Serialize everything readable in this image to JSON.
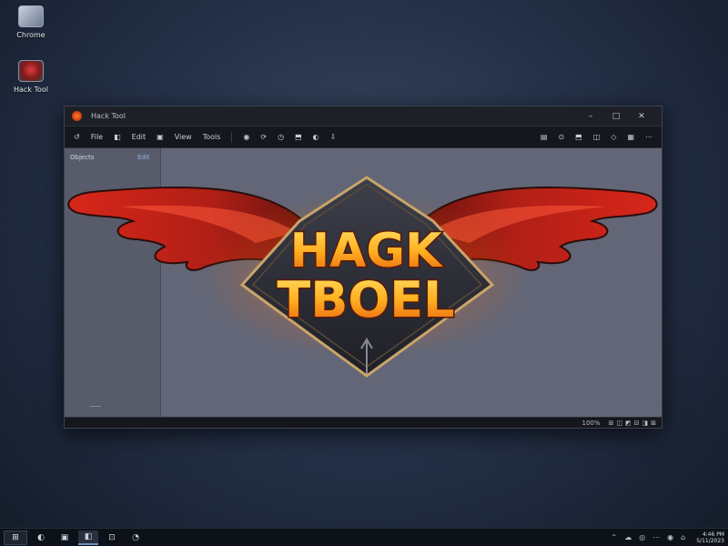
{
  "desktop": {
    "icons": [
      {
        "label": "Chrome",
        "icon": "app-icon"
      },
      {
        "label": "Hack Tool",
        "icon": "bat-logo-icon"
      }
    ]
  },
  "window": {
    "title": "Hack Tool",
    "controls": {
      "minimize": "–",
      "maximize": "□",
      "close": "✕"
    },
    "toolbar": {
      "left": [
        {
          "label": "↺",
          "icon": "refresh-icon"
        },
        {
          "label": "File",
          "icon": ""
        },
        {
          "label": "◧",
          "icon": "layers-icon"
        },
        {
          "label": "Edit",
          "icon": ""
        },
        {
          "label": "▣",
          "icon": "frame-icon"
        },
        {
          "label": "View",
          "icon": ""
        },
        {
          "label": "Tools",
          "icon": ""
        },
        {
          "label": "◉",
          "icon": "record-icon"
        },
        {
          "label": "⟳",
          "icon": "sync-icon"
        },
        {
          "label": "◷",
          "icon": "clock-icon"
        },
        {
          "label": "⬒",
          "icon": "folder-icon"
        },
        {
          "label": "◐",
          "icon": "contrast-icon"
        },
        {
          "label": "⇩",
          "icon": "download-icon"
        }
      ],
      "right": [
        "▤",
        "⊙",
        "⬒",
        "◫",
        "◇",
        "▦",
        "⋯"
      ]
    },
    "sidebar": {
      "label": "Objects",
      "link": "Edit",
      "footer": "——"
    },
    "logo": {
      "line1": "HAGK",
      "line2": "TBOEL"
    },
    "status": {
      "zoom": "100%",
      "icons": [
        "⊞",
        "◫",
        "◩",
        "⊟",
        "◨",
        "⊠"
      ]
    }
  },
  "taskbar": {
    "start": "⊞",
    "items": [
      "◐",
      "▣",
      "◧",
      "⊡",
      "◔"
    ],
    "tray": [
      "⌃",
      "☁",
      "◎",
      "⋯",
      "◉",
      "⌂"
    ],
    "time": "4:46 PM",
    "date": "5/11/2023"
  }
}
